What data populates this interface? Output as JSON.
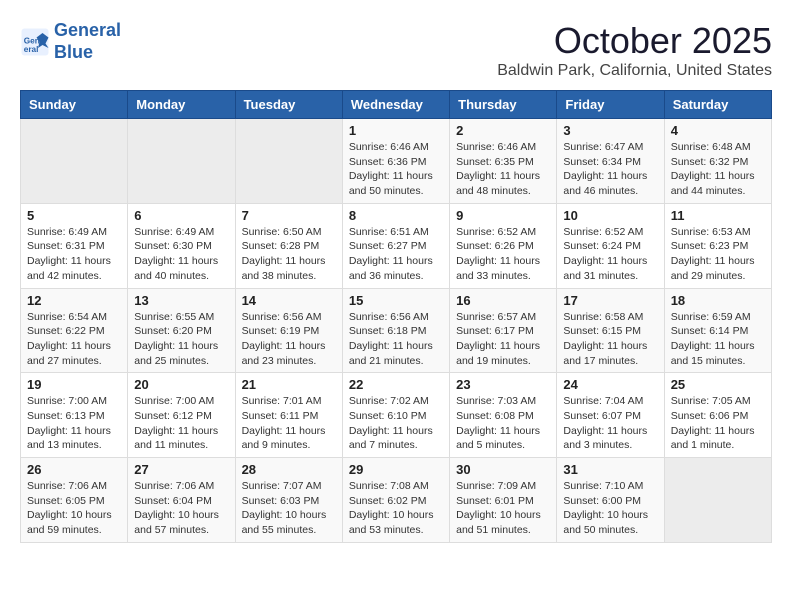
{
  "header": {
    "logo_line1": "General",
    "logo_line2": "Blue",
    "month": "October 2025",
    "location": "Baldwin Park, California, United States"
  },
  "weekdays": [
    "Sunday",
    "Monday",
    "Tuesday",
    "Wednesday",
    "Thursday",
    "Friday",
    "Saturday"
  ],
  "weeks": [
    [
      {
        "day": "",
        "info": ""
      },
      {
        "day": "",
        "info": ""
      },
      {
        "day": "",
        "info": ""
      },
      {
        "day": "1",
        "info": "Sunrise: 6:46 AM\nSunset: 6:36 PM\nDaylight: 11 hours\nand 50 minutes."
      },
      {
        "day": "2",
        "info": "Sunrise: 6:46 AM\nSunset: 6:35 PM\nDaylight: 11 hours\nand 48 minutes."
      },
      {
        "day": "3",
        "info": "Sunrise: 6:47 AM\nSunset: 6:34 PM\nDaylight: 11 hours\nand 46 minutes."
      },
      {
        "day": "4",
        "info": "Sunrise: 6:48 AM\nSunset: 6:32 PM\nDaylight: 11 hours\nand 44 minutes."
      }
    ],
    [
      {
        "day": "5",
        "info": "Sunrise: 6:49 AM\nSunset: 6:31 PM\nDaylight: 11 hours\nand 42 minutes."
      },
      {
        "day": "6",
        "info": "Sunrise: 6:49 AM\nSunset: 6:30 PM\nDaylight: 11 hours\nand 40 minutes."
      },
      {
        "day": "7",
        "info": "Sunrise: 6:50 AM\nSunset: 6:28 PM\nDaylight: 11 hours\nand 38 minutes."
      },
      {
        "day": "8",
        "info": "Sunrise: 6:51 AM\nSunset: 6:27 PM\nDaylight: 11 hours\nand 36 minutes."
      },
      {
        "day": "9",
        "info": "Sunrise: 6:52 AM\nSunset: 6:26 PM\nDaylight: 11 hours\nand 33 minutes."
      },
      {
        "day": "10",
        "info": "Sunrise: 6:52 AM\nSunset: 6:24 PM\nDaylight: 11 hours\nand 31 minutes."
      },
      {
        "day": "11",
        "info": "Sunrise: 6:53 AM\nSunset: 6:23 PM\nDaylight: 11 hours\nand 29 minutes."
      }
    ],
    [
      {
        "day": "12",
        "info": "Sunrise: 6:54 AM\nSunset: 6:22 PM\nDaylight: 11 hours\nand 27 minutes."
      },
      {
        "day": "13",
        "info": "Sunrise: 6:55 AM\nSunset: 6:20 PM\nDaylight: 11 hours\nand 25 minutes."
      },
      {
        "day": "14",
        "info": "Sunrise: 6:56 AM\nSunset: 6:19 PM\nDaylight: 11 hours\nand 23 minutes."
      },
      {
        "day": "15",
        "info": "Sunrise: 6:56 AM\nSunset: 6:18 PM\nDaylight: 11 hours\nand 21 minutes."
      },
      {
        "day": "16",
        "info": "Sunrise: 6:57 AM\nSunset: 6:17 PM\nDaylight: 11 hours\nand 19 minutes."
      },
      {
        "day": "17",
        "info": "Sunrise: 6:58 AM\nSunset: 6:15 PM\nDaylight: 11 hours\nand 17 minutes."
      },
      {
        "day": "18",
        "info": "Sunrise: 6:59 AM\nSunset: 6:14 PM\nDaylight: 11 hours\nand 15 minutes."
      }
    ],
    [
      {
        "day": "19",
        "info": "Sunrise: 7:00 AM\nSunset: 6:13 PM\nDaylight: 11 hours\nand 13 minutes."
      },
      {
        "day": "20",
        "info": "Sunrise: 7:00 AM\nSunset: 6:12 PM\nDaylight: 11 hours\nand 11 minutes."
      },
      {
        "day": "21",
        "info": "Sunrise: 7:01 AM\nSunset: 6:11 PM\nDaylight: 11 hours\nand 9 minutes."
      },
      {
        "day": "22",
        "info": "Sunrise: 7:02 AM\nSunset: 6:10 PM\nDaylight: 11 hours\nand 7 minutes."
      },
      {
        "day": "23",
        "info": "Sunrise: 7:03 AM\nSunset: 6:08 PM\nDaylight: 11 hours\nand 5 minutes."
      },
      {
        "day": "24",
        "info": "Sunrise: 7:04 AM\nSunset: 6:07 PM\nDaylight: 11 hours\nand 3 minutes."
      },
      {
        "day": "25",
        "info": "Sunrise: 7:05 AM\nSunset: 6:06 PM\nDaylight: 11 hours\nand 1 minute."
      }
    ],
    [
      {
        "day": "26",
        "info": "Sunrise: 7:06 AM\nSunset: 6:05 PM\nDaylight: 10 hours\nand 59 minutes."
      },
      {
        "day": "27",
        "info": "Sunrise: 7:06 AM\nSunset: 6:04 PM\nDaylight: 10 hours\nand 57 minutes."
      },
      {
        "day": "28",
        "info": "Sunrise: 7:07 AM\nSunset: 6:03 PM\nDaylight: 10 hours\nand 55 minutes."
      },
      {
        "day": "29",
        "info": "Sunrise: 7:08 AM\nSunset: 6:02 PM\nDaylight: 10 hours\nand 53 minutes."
      },
      {
        "day": "30",
        "info": "Sunrise: 7:09 AM\nSunset: 6:01 PM\nDaylight: 10 hours\nand 51 minutes."
      },
      {
        "day": "31",
        "info": "Sunrise: 7:10 AM\nSunset: 6:00 PM\nDaylight: 10 hours\nand 50 minutes."
      },
      {
        "day": "",
        "info": ""
      }
    ]
  ]
}
